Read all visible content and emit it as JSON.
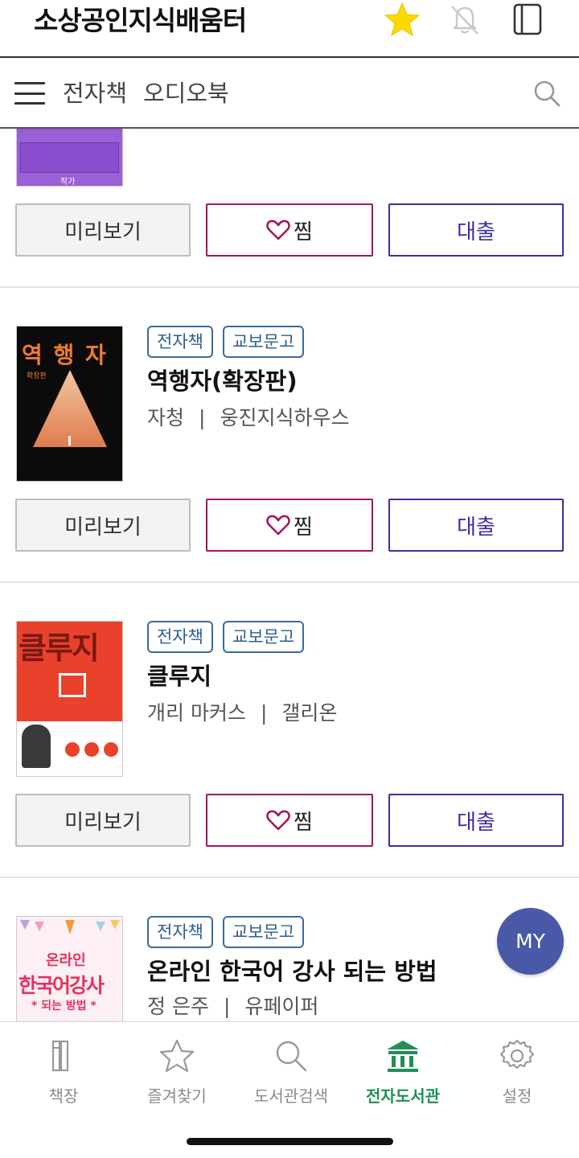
{
  "header": {
    "app_title": "소상공인지식배움터"
  },
  "subnav": {
    "tabs": [
      "전자책",
      "오디오북"
    ]
  },
  "actions": {
    "preview": "미리보기",
    "wish": "찜",
    "loan": "대출"
  },
  "books": [
    {
      "badges": [
        "전자책",
        "교보문고"
      ],
      "title": "역행자(확장판)",
      "author": "자청",
      "publisher": "웅진지식하우스",
      "cover_title": "역 행 자",
      "cover_sub": "확장판"
    },
    {
      "badges": [
        "전자책",
        "교보문고"
      ],
      "title": "클루지",
      "author": "개리 마커스",
      "publisher": "갤리온",
      "cover_title": "클루지"
    },
    {
      "badges": [
        "전자책",
        "교보문고"
      ],
      "title": "온라인 한국어 강사 되는 방법",
      "author": "정 은주",
      "publisher": "유페이퍼",
      "cover_title_line1": "온라인",
      "cover_title_line2": "한국어강사",
      "cover_title_line3": "* 되는 방법 *"
    }
  ],
  "partial_top_book": {
    "cover_caption": "작가"
  },
  "fab": {
    "label": "MY"
  },
  "bottom_nav": [
    {
      "label": "책장",
      "icon": "bookshelf-icon"
    },
    {
      "label": "즐겨찾기",
      "icon": "star-outline-icon"
    },
    {
      "label": "도서관검색",
      "icon": "search-icon"
    },
    {
      "label": "전자도서관",
      "icon": "library-icon",
      "active": true
    },
    {
      "label": "설정",
      "icon": "gear-icon"
    }
  ],
  "colors": {
    "accent_green": "#1f8f55",
    "star_yellow": "#ffd800",
    "wish_border": "#a3165c",
    "loan_border": "#3a2ea3",
    "badge_border": "#3b6a9a",
    "fab": "#4a58a8"
  }
}
